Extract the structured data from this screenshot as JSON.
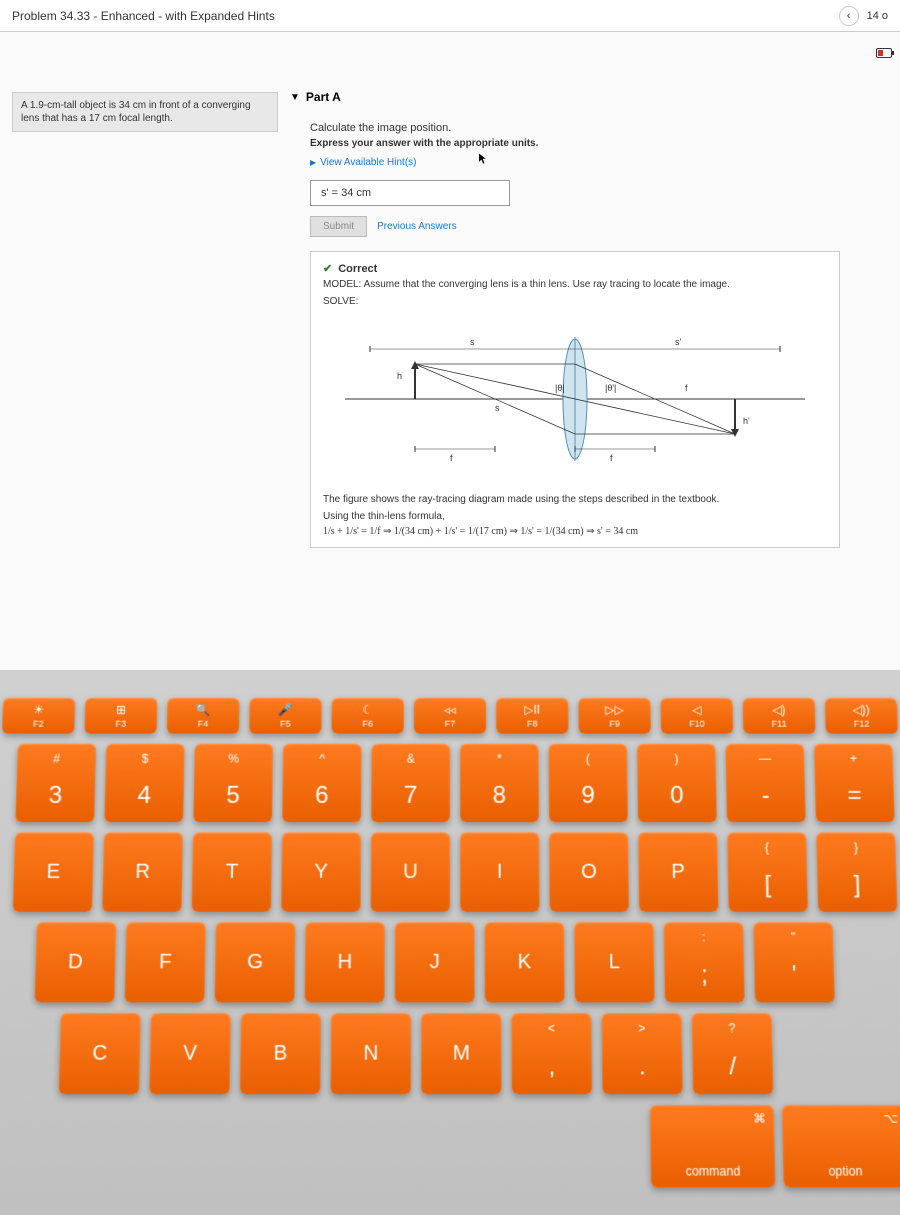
{
  "header": {
    "title": "Problem 34.33 - Enhanced - with Expanded Hints",
    "page_indicator": "14 o"
  },
  "problem": {
    "statement": "A 1.9-cm-tall object is 34 cm in front of a converging lens that has a 17 cm focal length."
  },
  "part": {
    "label": "Part A",
    "instruction": "Calculate the image position.",
    "answer_format": "Express your answer with the appropriate units.",
    "hint_link": "View Available Hint(s)",
    "answer_value": "s' = 34 cm",
    "submit_label": "Submit",
    "previous_link": "Previous Answers"
  },
  "feedback": {
    "status": "Correct",
    "model_text": "MODEL: Assume that the converging lens is a thin lens. Use ray tracing to locate the image.",
    "solve_label": "SOLVE:",
    "figure_caption": "The figure shows the ray-tracing diagram made using the steps described in the textbook.",
    "formula_intro": "Using the thin-lens formula,",
    "formula": "1/s + 1/s' = 1/f  ⇒  1/(34 cm) + 1/s' = 1/(17 cm)  ⇒  1/s' = 1/(34 cm)  ⇒  s' = 34 cm"
  },
  "chart_data": {
    "type": "diagram",
    "description": "Ray tracing diagram for converging thin lens",
    "object_distance_cm": 34,
    "focal_length_cm": 17,
    "image_distance_cm": 34,
    "object_height_cm": 1.9,
    "labels": [
      "h",
      "s",
      "f",
      "|θ|",
      "|θ'|",
      "s'",
      "h'",
      "f"
    ]
  },
  "keyboard": {
    "fn_row": [
      {
        "icon": "☀",
        "label": "F2"
      },
      {
        "icon": "⊞",
        "label": "F3"
      },
      {
        "icon": "🔍",
        "label": "F4"
      },
      {
        "icon": "🎤",
        "label": "F5"
      },
      {
        "icon": "☾",
        "label": "F6"
      },
      {
        "icon": "◃◃",
        "label": "F7"
      },
      {
        "icon": "▷II",
        "label": "F8"
      },
      {
        "icon": "▷▷",
        "label": "F9"
      },
      {
        "icon": "◁",
        "label": "F10"
      },
      {
        "icon": "◁)",
        "label": "F11"
      },
      {
        "icon": "◁))",
        "label": "F12"
      }
    ],
    "num_row": [
      {
        "top": "#",
        "main": "3"
      },
      {
        "top": "$",
        "main": "4"
      },
      {
        "top": "%",
        "main": "5"
      },
      {
        "top": "^",
        "main": "6"
      },
      {
        "top": "&",
        "main": "7"
      },
      {
        "top": "*",
        "main": "8"
      },
      {
        "top": "(",
        "main": "9"
      },
      {
        "top": ")",
        "main": "0"
      },
      {
        "top": "—",
        "main": "-"
      },
      {
        "top": "+",
        "main": "="
      }
    ],
    "row_q": [
      "E",
      "R",
      "T",
      "Y",
      "U",
      "I",
      "O",
      "P"
    ],
    "row_q_brackets": [
      {
        "top": "{",
        "main": "["
      },
      {
        "top": "}",
        "main": "]"
      }
    ],
    "row_a": [
      "D",
      "F",
      "G",
      "H",
      "J",
      "K",
      "L"
    ],
    "row_a_right": [
      {
        "top": ":",
        "main": ";"
      },
      {
        "top": "\"",
        "main": "'"
      }
    ],
    "row_z": [
      "C",
      "V",
      "B",
      "N",
      "M"
    ],
    "row_z_right": [
      {
        "top": "<",
        "main": ","
      },
      {
        "top": ">",
        "main": "."
      },
      {
        "top": "?",
        "main": "/"
      }
    ],
    "modifiers": {
      "command": "command",
      "option": "option",
      "cmd_sym": "⌘",
      "opt_sym": "⌥"
    }
  }
}
